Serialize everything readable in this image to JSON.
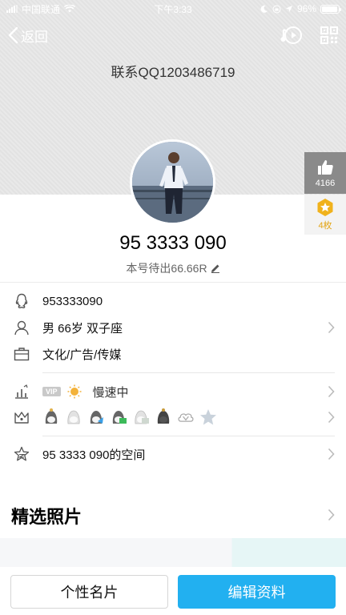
{
  "status_bar": {
    "carrier": "中国联通",
    "time": "下午3:33",
    "battery": "96%",
    "battery_level": 0.96
  },
  "nav": {
    "back_label": "返回",
    "icons": [
      "back-chevron-icon",
      "music-icon",
      "qr-code-icon"
    ]
  },
  "profile": {
    "signature": "联系QQ1203486719",
    "nickname": "95 3333 090",
    "status": "本号待出66.66R",
    "likes": "4166",
    "badge_count": "4枚"
  },
  "info": {
    "qq_number": "953333090",
    "demographics": "男 66岁 双子座",
    "occupation": "文化/广告/传媒",
    "vip_label": "VIP",
    "speed_status": "慢速中",
    "space": "95 3333 090的空间"
  },
  "photos": {
    "title": "精选照片"
  },
  "actions": {
    "card_button": "个性名片",
    "edit_button": "编辑资料"
  },
  "colors": {
    "accent": "#22b0f0",
    "badge_gold": "#e3a514",
    "like_bg": "#8a8a8a"
  }
}
